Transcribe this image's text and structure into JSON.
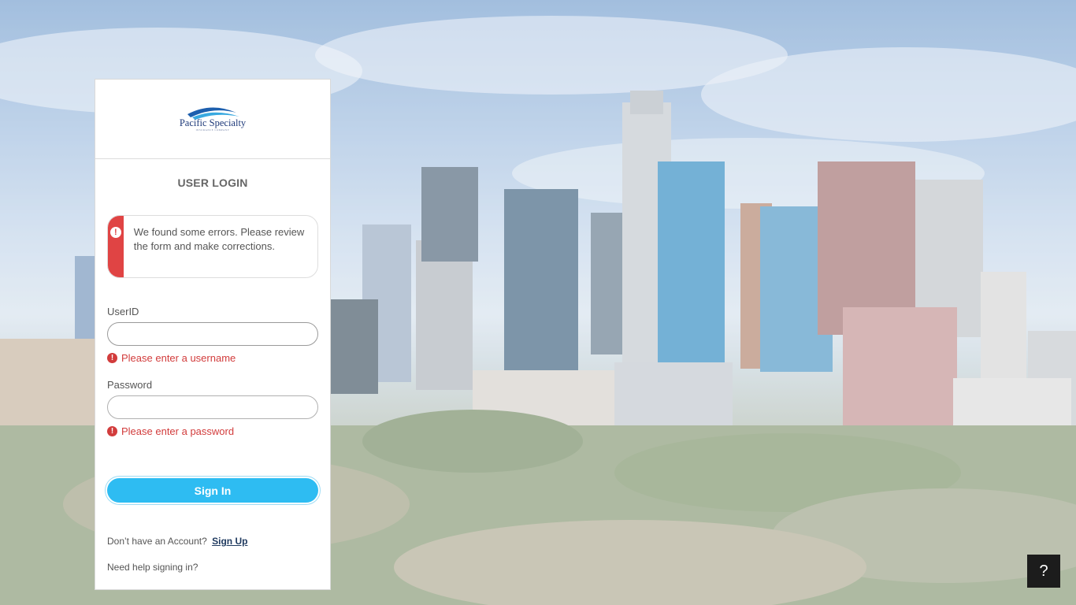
{
  "logo": {
    "name": "Pacific Specialty",
    "tagline": "INSURANCE COMPANY",
    "colors": {
      "wave_dark": "#1d5fae",
      "wave_light": "#39a9e0",
      "text": "#1f3a7a"
    }
  },
  "login": {
    "title": "USER LOGIN",
    "alert": {
      "icon": "exclamation-circle-icon",
      "message": "We found some errors. Please review the form and make corrections."
    },
    "userid": {
      "label": "UserID",
      "value": "",
      "error": "Please enter a username"
    },
    "password": {
      "label": "Password",
      "value": "",
      "error": "Please enter a password"
    },
    "signin_label": "Sign In",
    "signup_prompt": "Don’t have an Account?",
    "signup_link": "Sign Up",
    "help_text": "Need help signing in?"
  },
  "help_button": {
    "label": "?",
    "icon": "question-mark-icon"
  },
  "colors": {
    "accent": "#2ebcf2",
    "error": "#d23c3c",
    "alert_bar": "#e04444",
    "help_button_bg": "#1c1c1c"
  }
}
